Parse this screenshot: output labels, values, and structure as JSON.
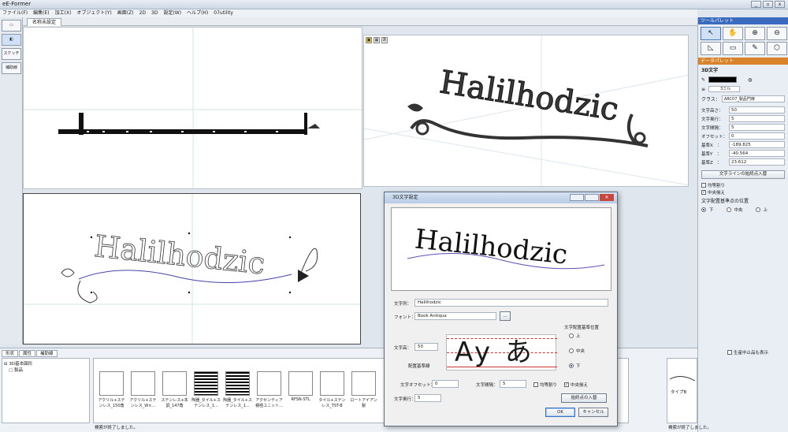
{
  "window": {
    "title": "eE-Former",
    "min": "_",
    "max": "▫",
    "close": "x"
  },
  "menu": [
    "ファイル(F)",
    "編集(E)",
    "加工(X)",
    "オブジェクト(Y)",
    "画面(Z)",
    "2D",
    "3D",
    "設定(W)",
    "ヘルプ(H)",
    "07utility"
  ],
  "toolbox": {
    "btn_sketch": "スケッチバンド",
    "btn_aux": "補助線"
  },
  "doc_tab": "名称未設定",
  "viewport": {
    "sign_text": "Halilhodzic"
  },
  "palette": {
    "tool_header": "ツールパレット",
    "data_header": "データパレット",
    "section": "3D文字",
    "swatch_label": "3ミル",
    "class_label": "クラス：",
    "class_value": "ARC07_製品門扉",
    "props": [
      {
        "label": "文字高さ：",
        "value": "50"
      },
      {
        "label": "文字奥行：",
        "value": "5"
      },
      {
        "label": "文字間隔：",
        "value": "5"
      },
      {
        "label": "オフセット：",
        "value": "0"
      },
      {
        "label": "基準X　：",
        "value": "-189.825"
      },
      {
        "label": "基準Y　：",
        "value": "-40.564"
      },
      {
        "label": "基準Z　：",
        "value": "23.612"
      }
    ],
    "button_wrap": "文字ラインの始終点入替",
    "check_even": "均等割り",
    "check_center": "中央揃え",
    "base_pos_label": "文字配置基準点の位置",
    "radio_labels": [
      "下",
      "中央",
      "上"
    ]
  },
  "bottom": {
    "tabs": [
      "形状",
      "属性",
      "補助線"
    ],
    "tree": [
      "3D基本図形",
      "製品"
    ],
    "parts": [
      {
        "label": "アクリル+ステンレス_150角"
      },
      {
        "label": "アクリル+ステンレス_W×..."
      },
      {
        "label": "ステンレス+本調_147角"
      },
      {
        "label": "陶器_タイル+ステンレス_1..."
      },
      {
        "label": "陶器_タイル+ステンレス_1..."
      },
      {
        "label": "アクセンティア積極ユニット..."
      },
      {
        "label": "RFSN-STL"
      },
      {
        "label": "タイル+ステンレス_TST-B"
      },
      {
        "label": "ロートアイアン製"
      }
    ],
    "status": "検索が終了しました。",
    "status_right": "検索が終了しました。",
    "right_item": "タイプB",
    "check_production": "生産中止品も表示"
  },
  "dialog": {
    "title": "3D文字設定",
    "preview_text": "Halilhodzic",
    "text_label": "文字列：",
    "text_value": "Halilhodzic",
    "font_label": "フォント：",
    "font_value": "Book Antiqua",
    "font_btn": "...",
    "height_label": "文字高：",
    "height_value": "50",
    "baseline_label": "配置基準線",
    "glyphs": "Ay あ",
    "pos_title": "文字配置基準位置",
    "pos_options": [
      "上",
      "中央",
      "下"
    ],
    "offset_label": "文字オフセット：",
    "offset_value": "0",
    "spacing_label": "文字間隔：",
    "spacing_value": "5",
    "even_label": "均等割り",
    "center_label": "中央揃え",
    "depth_label": "文字奥行：",
    "depth_value": "5",
    "swap_btn": "始終点の入替",
    "ok": "OK",
    "cancel": "キャンセル"
  }
}
